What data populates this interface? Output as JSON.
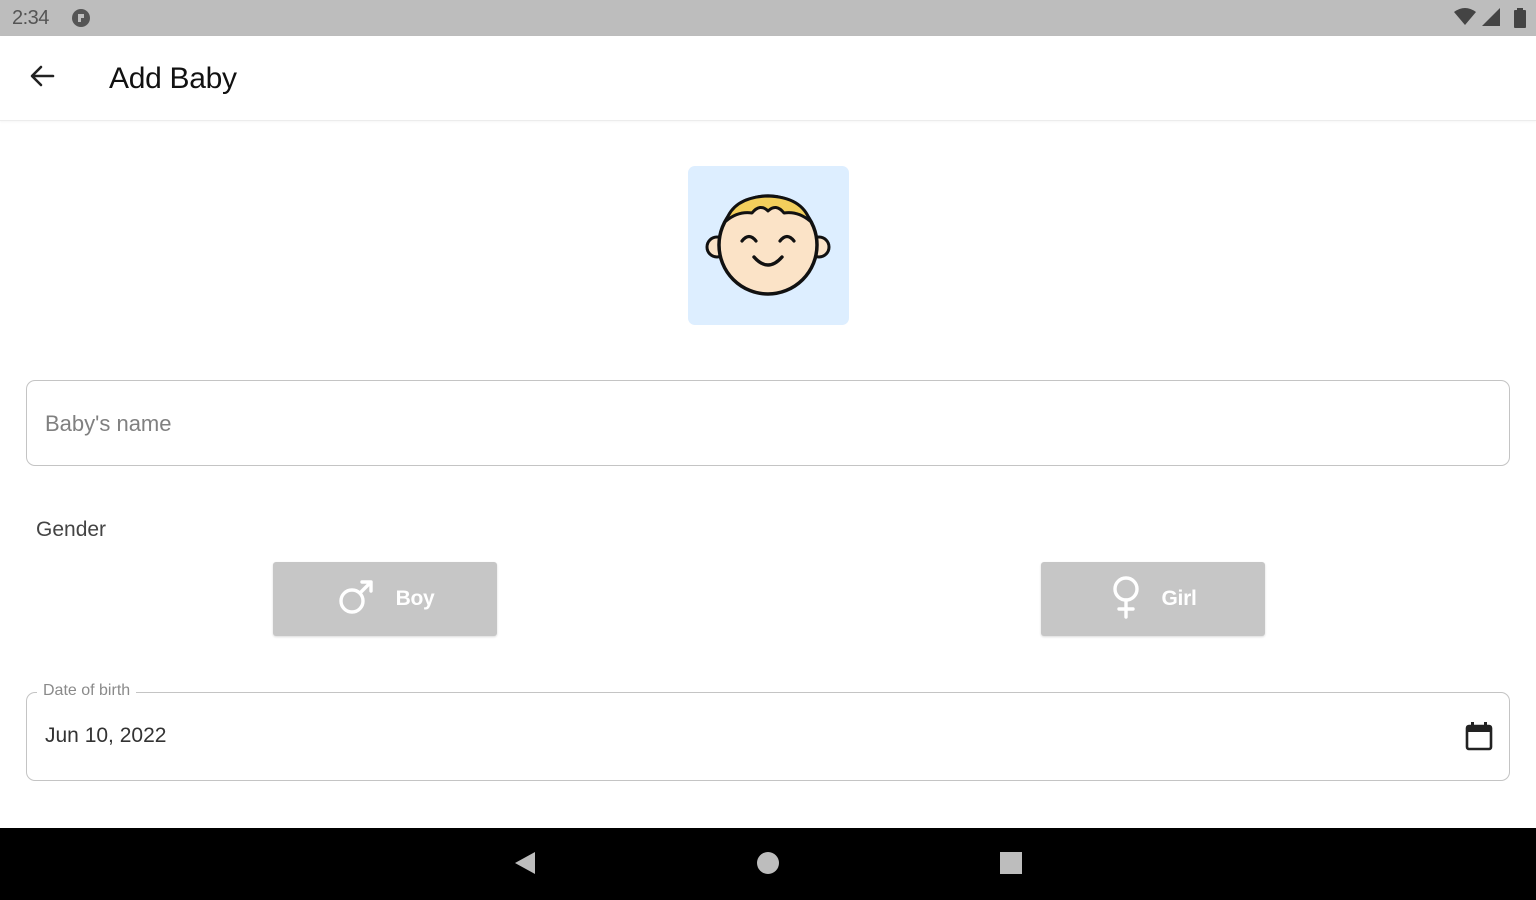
{
  "status_bar": {
    "time": "2:34",
    "icons": [
      "notification-icon",
      "wifi-icon",
      "cellular-icon",
      "battery-icon"
    ]
  },
  "app_bar": {
    "back_icon": "arrow-left-icon",
    "title": "Add Baby"
  },
  "avatar": {
    "icon": "baby-face-icon",
    "background": "#ddeeff"
  },
  "name_field": {
    "placeholder": "Baby's name",
    "value": ""
  },
  "gender": {
    "label": "Gender",
    "options": [
      {
        "label": "Boy",
        "icon": "male-symbol-icon"
      },
      {
        "label": "Girl",
        "icon": "female-symbol-icon"
      }
    ],
    "button_color": "#c6c6c6"
  },
  "date_of_birth": {
    "label": "Date of birth",
    "value": "Jun 10, 2022",
    "icon": "calendar-icon"
  },
  "nav_bar": {
    "buttons": [
      "back-triangle-icon",
      "home-circle-icon",
      "recents-square-icon"
    ]
  }
}
